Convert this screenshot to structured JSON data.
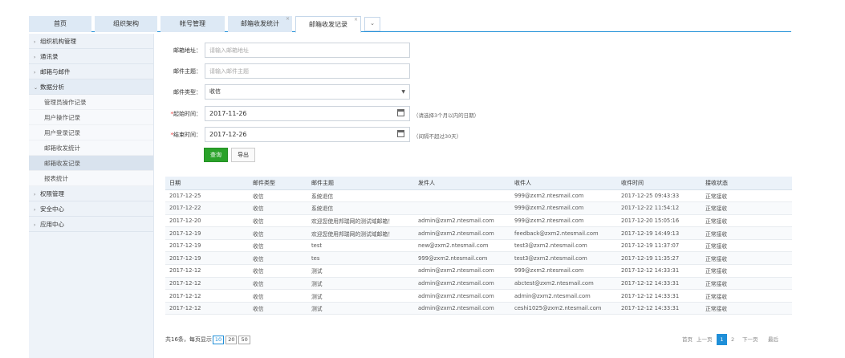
{
  "nav": {
    "tabs": [
      "首页",
      "组织架构",
      "帐号管理",
      "邮箱收发统计",
      "邮箱收发记录"
    ],
    "close_glyph": "×",
    "more_glyph": "⌄"
  },
  "sidebar": {
    "arrow_closed": "›",
    "arrow_open": "⌄",
    "groups_top": [
      "组织机构管理",
      "通讯录",
      "邮箱与邮件"
    ],
    "open_group": "数据分析",
    "sub_items": [
      "管理员操作记录",
      "用户操作记录",
      "用户登录记录",
      "邮箱收发统计",
      "邮箱收发记录",
      "报表统计"
    ],
    "groups_bottom": [
      "权限管理",
      "安全中心",
      "应用中心"
    ]
  },
  "form": {
    "address_label": "邮箱地址：",
    "address_placeholder": "请输入邮箱地址",
    "subject_label": "邮件主题：",
    "subject_placeholder": "请输入邮件主题",
    "type_label": "邮件类型：",
    "type_value": "收信",
    "required_star": "*",
    "start_label": "起始时间：",
    "start_value": "2017-11-26",
    "start_hint": "（请选择3个月以内的日期）",
    "end_label": "结束时间：",
    "end_value": "2017-12-26",
    "end_hint": "（间隔不超过30天）",
    "query_button": "查询",
    "export_button": "导出"
  },
  "table": {
    "headers": [
      "日期",
      "邮件类型",
      "邮件主题",
      "发件人",
      "收件人",
      "收件时间",
      "接收状态"
    ],
    "rows": [
      [
        "2017-12-25",
        "收信",
        "系统退信",
        "",
        "999@zxm2.ntesmail.com",
        "2017-12-25 09:43:33",
        "正常接收"
      ],
      [
        "2017-12-22",
        "收信",
        "系统退信",
        "",
        "999@zxm2.ntesmail.com",
        "2017-12-22 11:54:12",
        "正常接收"
      ],
      [
        "2017-12-20",
        "收信",
        "欢迎您使用邦瑞网的测试域邮箱！",
        "admin@zxm2.ntesmail.com",
        "999@zxm2.ntesmail.com",
        "2017-12-20 15:05:16",
        "正常接收"
      ],
      [
        "2017-12-19",
        "收信",
        "欢迎您使用邦瑞网的测试域邮箱！",
        "admin@zxm2.ntesmail.com",
        "feedback@zxm2.ntesmail.com",
        "2017-12-19 14:49:13",
        "正常接收"
      ],
      [
        "2017-12-19",
        "收信",
        "test",
        "new@zxm2.ntesmail.com",
        "test3@zxm2.ntesmail.com",
        "2017-12-19 11:37:07",
        "正常接收"
      ],
      [
        "2017-12-19",
        "收信",
        "tes",
        "999@zxm2.ntesmail.com",
        "test3@zxm2.ntesmail.com",
        "2017-12-19 11:35:27",
        "正常接收"
      ],
      [
        "2017-12-12",
        "收信",
        "测试",
        "admin@zxm2.ntesmail.com",
        "999@zxm2.ntesmail.com",
        "2017-12-12 14:33:31",
        "正常接收"
      ],
      [
        "2017-12-12",
        "收信",
        "测试",
        "admin@zxm2.ntesmail.com",
        "abctest@zxm2.ntesmail.com",
        "2017-12-12 14:33:31",
        "正常接收"
      ],
      [
        "2017-12-12",
        "收信",
        "测试",
        "admin@zxm2.ntesmail.com",
        "admin@zxm2.ntesmail.com",
        "2017-12-12 14:33:31",
        "正常接收"
      ],
      [
        "2017-12-12",
        "收信",
        "测试",
        "admin@zxm2.ntesmail.com",
        "ceshi1025@zxm2.ntesmail.com",
        "2017-12-12 14:33:31",
        "正常接收"
      ]
    ]
  },
  "footer": {
    "total_prefix": "共16条，每页显示",
    "page_sizes": [
      "10",
      "20",
      "50"
    ],
    "pager": {
      "first": "首页",
      "prev": "上一页",
      "current": "1",
      "page2": "2",
      "next": "下一页",
      "last": "最后"
    }
  }
}
